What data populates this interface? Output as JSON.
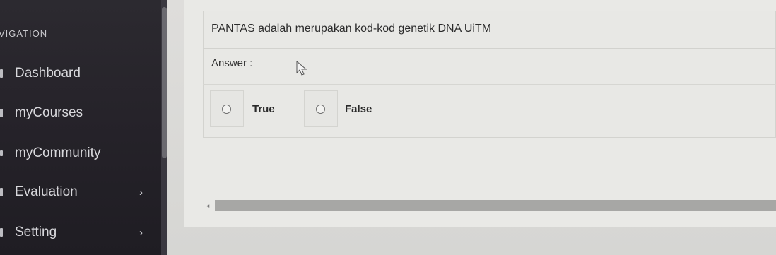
{
  "sidebar": {
    "heading": "VIGATION",
    "items": [
      {
        "label": "Dashboard",
        "has_chevron": false
      },
      {
        "label": "myCourses",
        "has_chevron": false
      },
      {
        "label": "myCommunity",
        "has_chevron": false
      },
      {
        "label": "Evaluation",
        "has_chevron": true
      },
      {
        "label": "Setting",
        "has_chevron": true
      }
    ],
    "chevron": "›"
  },
  "question": {
    "text": "PANTAS adalah merupakan kod-kod genetik DNA UiTM",
    "answer_label": "Answer :",
    "options": [
      {
        "label": "True",
        "selected": false
      },
      {
        "label": "False",
        "selected": false
      }
    ]
  },
  "scrollbar": {
    "left_arrow": "◂"
  },
  "icons": {
    "cursor": "mouse-pointer-icon",
    "chevron": "chevron-right-icon"
  }
}
